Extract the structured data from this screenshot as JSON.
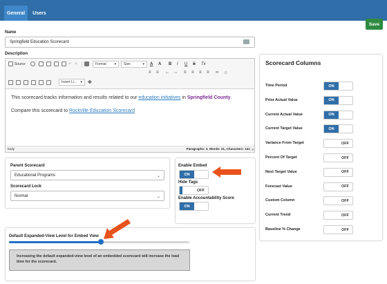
{
  "tabs": [
    {
      "label": "General"
    },
    {
      "label": "Users"
    }
  ],
  "toolbar": {
    "save_label": "Save"
  },
  "name": {
    "label": "Name",
    "value": "Springfield Education Scorecard"
  },
  "description": {
    "label": "Description",
    "editor_toolbar": {
      "source": "Source",
      "format": "Format",
      "size": "Size",
      "bold": "B",
      "italic": "I",
      "underline": "U",
      "strike": "S",
      "clear": "Tx",
      "insert": "Insert Li..."
    },
    "line1": {
      "prefix": "This scorecard tracks information and results related to our ",
      "link": "education initiatives",
      "middle": " in ",
      "emph": "Springfield County",
      "suffix": "."
    },
    "line2": {
      "prefix": "Compare this scorecard to ",
      "link": "Rockville Education Scorecard"
    },
    "footer_left": "body",
    "footer_right": "Paragraphs: 3, Words: 21, Characters: 141"
  },
  "parent": {
    "label": "Parent Scorecard",
    "value": "Educational Programs"
  },
  "lock": {
    "label": "Scorecard Lock",
    "value": "Normal"
  },
  "embed": {
    "enable_embed": {
      "label": "Enable Embed",
      "state": "ON"
    },
    "hide_tags": {
      "label": "Hide Tags",
      "state": "OFF"
    },
    "accountability": {
      "label": "Enable Accountability Score",
      "state": "ON"
    }
  },
  "embed_level": {
    "label": "Default Expanded-View Level for Embed View",
    "value_percent": 51,
    "note": "Increasing the default expanded-view level of an embedded scorecard will increase the load time for the scorecard."
  },
  "scorecard_columns": {
    "title": "Scorecard Columns",
    "items": [
      {
        "label": "Time Period",
        "state": "ON"
      },
      {
        "label": "Prior Actual Value",
        "state": "ON"
      },
      {
        "label": "Current Actual Value",
        "state": "ON"
      },
      {
        "label": "Current Target Value",
        "state": "ON"
      },
      {
        "label": "Variance From Target",
        "state": "OFF"
      },
      {
        "label": "Percent Of Target",
        "state": "OFF"
      },
      {
        "label": "Next Target Value",
        "state": "OFF"
      },
      {
        "label": "Forecast Value",
        "state": "OFF"
      },
      {
        "label": "Custom Column",
        "state": "OFF"
      },
      {
        "label": "Current Trend",
        "state": "OFF"
      },
      {
        "label": "Baseline % Change",
        "state": "OFF"
      }
    ]
  },
  "colors": {
    "primary": "#2f6ea8",
    "save": "#2e8b3f",
    "arrow": "#e8521c",
    "link": "#2a7bbf",
    "emph": "#7b2a8e"
  }
}
